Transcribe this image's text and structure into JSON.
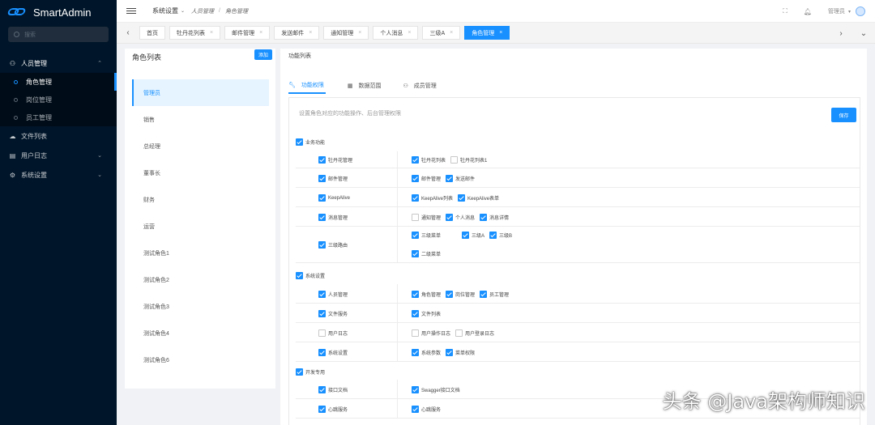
{
  "app": {
    "name": "SmartAdmin"
  },
  "sidebar": {
    "search_placeholder": "搜索",
    "menu": [
      {
        "label": "人员管理",
        "icon": "people-icon",
        "children": [
          "角色管理",
          "岗位管理",
          "员工管理"
        ],
        "active_child": "角色管理"
      },
      {
        "label": "文件列表",
        "icon": "cloud-icon"
      },
      {
        "label": "用户日志",
        "icon": "log-icon"
      },
      {
        "label": "系统设置",
        "icon": "settings-icon"
      }
    ]
  },
  "header": {
    "crumb_root": "系统设置",
    "crumb_mid": "人员管理",
    "crumb_sep": "/",
    "crumb_last": "角色管理",
    "user": "管理员"
  },
  "tabs": [
    {
      "label": "首页",
      "closable": false
    },
    {
      "label": "牡丹花列表",
      "closable": true
    },
    {
      "label": "邮件管理",
      "closable": true
    },
    {
      "label": "发送邮件",
      "closable": true
    },
    {
      "label": "通知管理",
      "closable": true
    },
    {
      "label": "个人消息",
      "closable": true
    },
    {
      "label": "三级A",
      "closable": true
    },
    {
      "label": "角色管理",
      "closable": true,
      "active": true
    }
  ],
  "roles": {
    "title": "角色列表",
    "add_label": "添加",
    "items": [
      "管理员",
      "销售",
      "总经理",
      "董事长",
      "财务",
      "运营",
      "测试角色1",
      "测试角色2",
      "测试角色3",
      "测试角色4",
      "测试角色6"
    ],
    "selected": "管理员"
  },
  "perm": {
    "title": "功能列表",
    "tabs": [
      {
        "label": "功能权限",
        "icon": "wrench-icon",
        "active": true
      },
      {
        "label": "数据范围",
        "icon": "table-icon"
      },
      {
        "label": "成员管理",
        "icon": "team-icon"
      }
    ],
    "description": "设置角色对应的功能操作、后台管理权限",
    "save_label": "保存",
    "groups": {
      "business": {
        "label": "业务功能",
        "checked": true
      },
      "system": {
        "label": "系统设置",
        "checked": true
      },
      "dev": {
        "label": "开发专用",
        "checked": true
      }
    },
    "rows": {
      "r1": {
        "name": "牡丹花管理",
        "checked": true,
        "items": [
          {
            "label": "牡丹花列表",
            "checked": true
          },
          {
            "label": "牡丹花列表1",
            "checked": false
          }
        ]
      },
      "r2": {
        "name": "邮件管理",
        "checked": true,
        "items": [
          {
            "label": "邮件管理",
            "checked": true
          },
          {
            "label": "发送邮件",
            "checked": true
          }
        ]
      },
      "r3": {
        "name": "KeepAlive",
        "checked": true,
        "items": [
          {
            "label": "KeepAlive列表",
            "checked": true
          },
          {
            "label": "KeepAlive表单",
            "checked": true
          }
        ]
      },
      "r4": {
        "name": "消息管理",
        "checked": true,
        "items": [
          {
            "label": "通知管理",
            "checked": false
          },
          {
            "label": "个人消息",
            "checked": true
          },
          {
            "label": "消息详情",
            "checked": true
          }
        ]
      },
      "r5": {
        "name": "三级路由",
        "checked": true,
        "items": [
          {
            "label": "三级菜单",
            "checked": true
          },
          {
            "label": "三级A",
            "checked": true
          },
          {
            "label": "三级B",
            "checked": true
          },
          {
            "label": "二级菜单",
            "checked": true
          }
        ]
      },
      "r6": {
        "name": "人员管理",
        "checked": true,
        "items": [
          {
            "label": "角色管理",
            "checked": true
          },
          {
            "label": "岗位管理",
            "checked": true
          },
          {
            "label": "员工管理",
            "checked": true
          }
        ]
      },
      "r7": {
        "name": "文件服务",
        "checked": true,
        "items": [
          {
            "label": "文件列表",
            "checked": true
          }
        ]
      },
      "r8": {
        "name": "用户日志",
        "checked": false,
        "items": [
          {
            "label": "用户操作日志",
            "checked": false
          },
          {
            "label": "用户登录日志",
            "checked": false
          }
        ]
      },
      "r9": {
        "name": "系统设置",
        "checked": true,
        "items": [
          {
            "label": "系统参数",
            "checked": true
          },
          {
            "label": "菜单权限",
            "checked": true
          }
        ]
      },
      "r10": {
        "name": "接口文档",
        "checked": true,
        "items": [
          {
            "label": "Swagger接口文档",
            "checked": true
          }
        ]
      },
      "r11": {
        "name": "心跳服务",
        "checked": true,
        "items": [
          {
            "label": "心跳服务",
            "checked": true
          }
        ]
      }
    }
  },
  "watermark": "头条 @Java架构师知识"
}
